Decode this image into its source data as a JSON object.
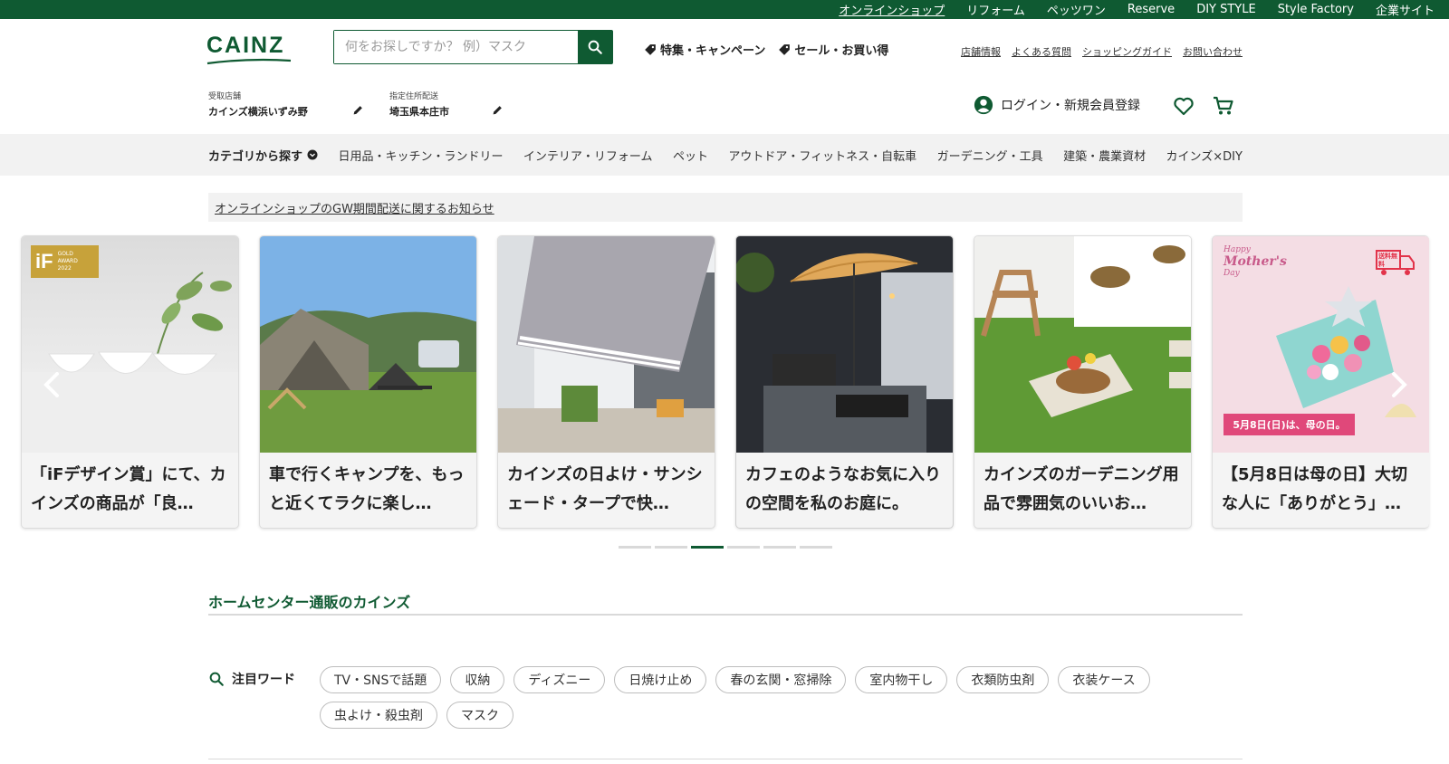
{
  "topbar": {
    "links": [
      "オンラインショップ",
      "リフォーム",
      "ペッツワン",
      "Reserve",
      "DIY STYLE",
      "Style Factory",
      "企業サイト"
    ]
  },
  "header": {
    "logo": "CAINZ",
    "search_placeholder": "何をお探しですか？ 例）マスク",
    "promo_links": [
      "特集・キャンペーン",
      "セール・お買い得"
    ],
    "util_links": [
      "店舗情報",
      "よくある質問",
      "ショッピングガイド",
      "お問い合わせ"
    ],
    "store_label": "受取店舗",
    "store_value": "カインズ横浜いずみ野",
    "address_label": "指定住所配送",
    "address_value": "埼玉県本庄市",
    "account_label": "ログイン・新規会員登録"
  },
  "catnav": {
    "main": "カテゴリから探す",
    "items": [
      "日用品・キッチン・ランドリー",
      "インテリア・リフォーム",
      "ペット",
      "アウトドア・フィットネス・自転車",
      "ガーデニング・工具",
      "建築・農業資材",
      "カインズ×DIY"
    ]
  },
  "notice": "オンラインショップのGW期間配送に関するお知らせ",
  "carousel": {
    "cards": [
      {
        "title": "「iFデザイン賞」にて、カインズの商品が「良…",
        "badge_line1": "GOLD",
        "badge_line2": "AWARD",
        "badge_line3": "2022"
      },
      {
        "title": "車で行くキャンプを、もっと近くてラクに楽し…"
      },
      {
        "title": "カインズの日よけ・サンシェード・タープで快…"
      },
      {
        "title": "カフェのようなお気に入りの空間を私のお庭に。"
      },
      {
        "title": "カインズのガーデニング用品で雰囲気のいいお…"
      },
      {
        "title": "【5月8日は母の日】大切な人に「ありがとう」…",
        "banner": "5月8日(日)は、母の日。",
        "tag": "送料無料",
        "script_line1": "Happy",
        "script_line2": "Mother's",
        "script_line3": "Day"
      }
    ],
    "active_dot": 2
  },
  "section": {
    "title": "ホームセンター通販のカインズ",
    "keywords_label": "注目ワード",
    "keywords": [
      "TV・SNSで話題",
      "収納",
      "ディズニー",
      "日焼け止め",
      "春の玄関・窓掃除",
      "室内物干し",
      "衣類防虫剤",
      "衣装ケース",
      "虫よけ・殺虫剤",
      "マスク"
    ]
  },
  "colors": {
    "brand": "#0f5a32",
    "nav_bg": "#f2f2f2"
  }
}
